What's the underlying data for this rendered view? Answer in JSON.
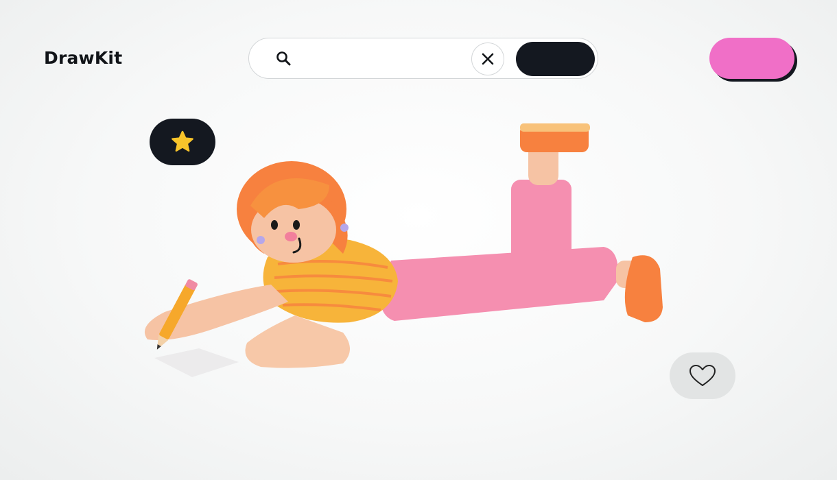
{
  "brand": {
    "name": "DrawKit"
  },
  "search": {
    "placeholder": "",
    "value": ""
  },
  "icons": {
    "search": "magnifier-icon",
    "clear": "close-x-icon",
    "favorite": "star-icon",
    "like": "heart-outline-icon"
  },
  "colors": {
    "accent_pink": "#f06fc7",
    "dark": "#141820",
    "star_yellow": "#f8c42a",
    "heart_pill_bg": "#e2e4e4"
  },
  "illustration": {
    "subject": "3d-character-lying-down-drawing-with-pencil",
    "outfit_colors": [
      "#f7b43a",
      "#f58fb0",
      "#f7813f"
    ]
  }
}
